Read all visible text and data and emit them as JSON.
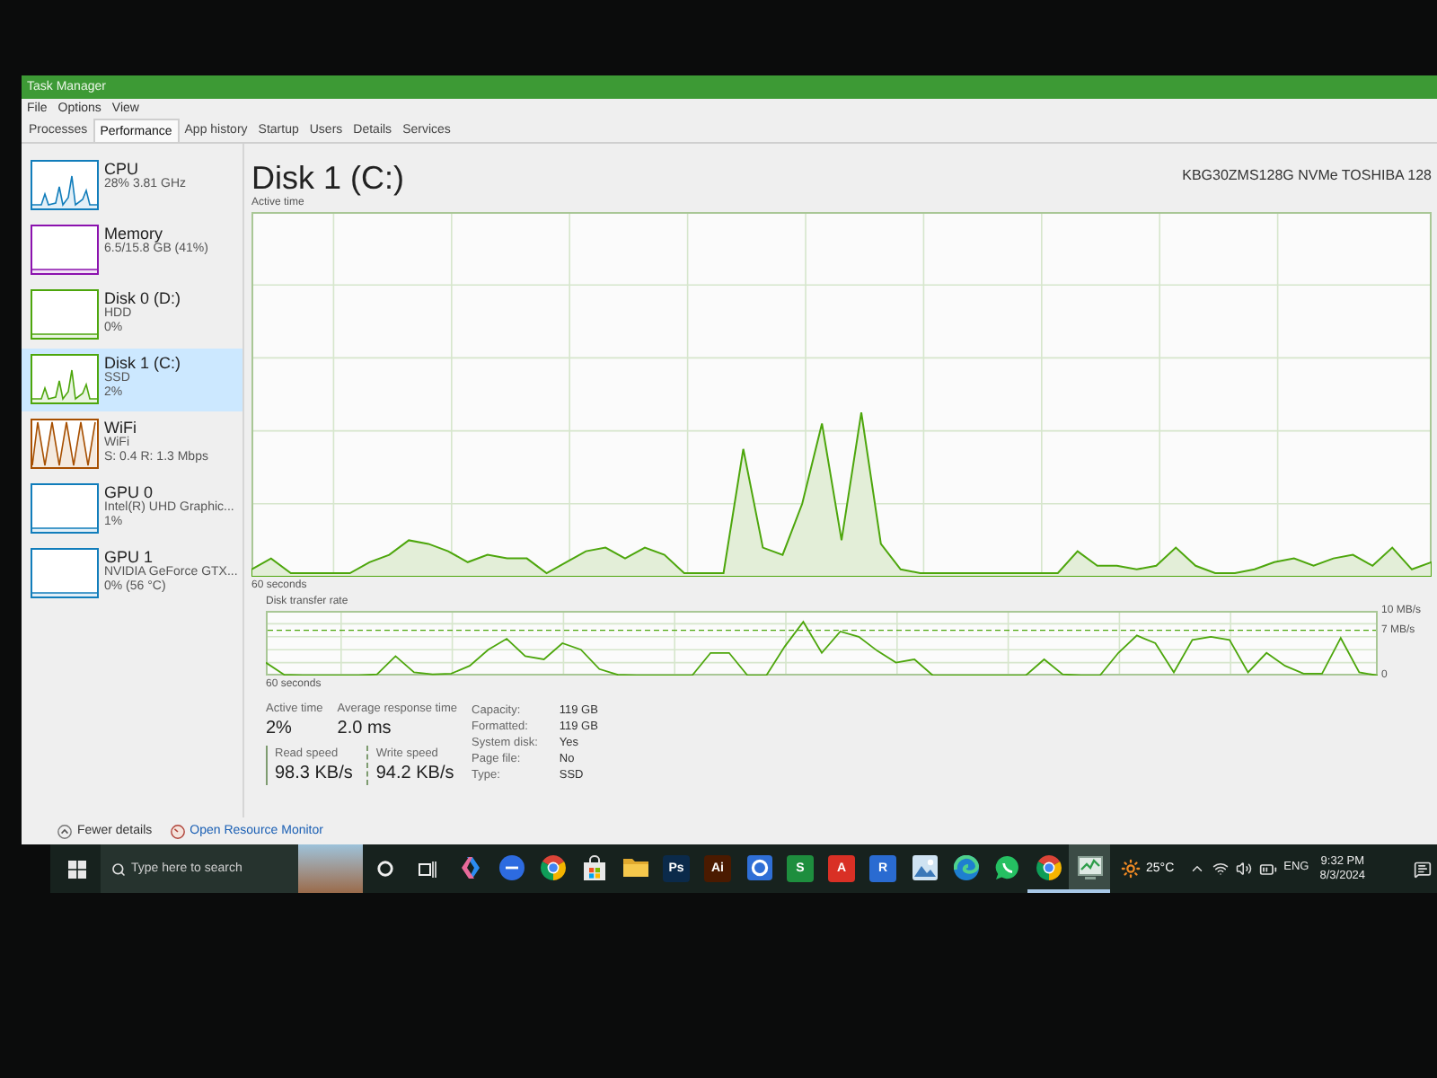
{
  "window": {
    "title": "Task Manager"
  },
  "menu": [
    "File",
    "Options",
    "View"
  ],
  "tabs": [
    {
      "label": "Processes",
      "selected": false
    },
    {
      "label": "Performance",
      "selected": true
    },
    {
      "label": "App history",
      "selected": false
    },
    {
      "label": "Startup",
      "selected": false
    },
    {
      "label": "Users",
      "selected": false
    },
    {
      "label": "Details",
      "selected": false
    },
    {
      "label": "Services",
      "selected": false
    }
  ],
  "sidebar": {
    "items": [
      {
        "name": "CPU",
        "details": [
          "28% 3.81 GHz"
        ],
        "color": "#117dbb",
        "kind": "spiky",
        "selected": false
      },
      {
        "name": "Memory",
        "details": [
          "6.5/15.8 GB (41%)"
        ],
        "color": "#8b12ae",
        "kind": "flat",
        "selected": false
      },
      {
        "name": "Disk 0 (D:)",
        "details": [
          "HDD",
          "0%"
        ],
        "color": "#4da60c",
        "kind": "flat",
        "selected": false
      },
      {
        "name": "Disk 1 (C:)",
        "details": [
          "SSD",
          "2%"
        ],
        "color": "#4da60c",
        "kind": "spiky",
        "selected": true
      },
      {
        "name": "WiFi",
        "details": [
          "WiFi",
          "S: 0.4 R: 1.3 Mbps"
        ],
        "color": "#a74f01",
        "kind": "wave",
        "selected": false
      },
      {
        "name": "GPU 0",
        "details": [
          "Intel(R) UHD Graphic...",
          "1%"
        ],
        "color": "#117dbb",
        "kind": "flat",
        "selected": false
      },
      {
        "name": "GPU 1",
        "details": [
          "NVIDIA GeForce GTX...",
          "0% (56 °C)"
        ],
        "color": "#117dbb",
        "kind": "flat",
        "selected": false
      }
    ]
  },
  "main": {
    "title": "Disk 1 (C:)",
    "model": "KBG30ZMS128G NVMe TOSHIBA 128",
    "active_time_graph": {
      "label": "Active time",
      "time_span": "60 seconds"
    },
    "transfer_graph": {
      "chart_data": {
        "type": "line",
        "title": "Disk transfer rate",
        "grid": true,
        "categories": [
          null,
          null,
          null,
          null,
          null,
          null,
          null,
          null,
          null,
          null,
          null,
          null,
          null,
          null,
          null,
          null,
          null,
          null,
          null,
          null,
          null,
          null,
          null,
          null,
          null,
          null,
          null,
          null,
          null,
          null,
          null,
          null,
          null,
          null,
          null,
          null,
          null,
          null,
          null,
          null,
          null,
          null,
          null,
          null,
          null,
          null,
          null,
          null,
          null,
          null,
          null,
          null,
          null,
          null,
          null,
          null,
          null,
          null,
          null,
          null,
          null
        ],
        "values": [
          2,
          0.1,
          0,
          0,
          0,
          0,
          0.2,
          3,
          0.5,
          0.2,
          0.3,
          1.5,
          4,
          5.7,
          3,
          2.5,
          5,
          4,
          1,
          0.1,
          0,
          0,
          0,
          0,
          3.5,
          3.5,
          0,
          0,
          4.5,
          8.3,
          3.5,
          6.8,
          6,
          3.8,
          2,
          2.5,
          0,
          0,
          0,
          0,
          0,
          0,
          2.5,
          0.2,
          0,
          0,
          3.5,
          6.2,
          5,
          0.5,
          5.5,
          6,
          5.5,
          0.5,
          3.5,
          1.5,
          0.3,
          0.3,
          5.8,
          0.5,
          0
        ],
        "ylim": [
          0,
          10
        ],
        "yticks": [
          {
            "value": 10,
            "label": "10 MB/s"
          },
          {
            "value": 0,
            "label": "0"
          }
        ],
        "ref_lines": [
          {
            "axis": "y",
            "value": 7,
            "label": "7 MB/s"
          }
        ],
        "annotations": [
          "60 seconds"
        ]
      }
    },
    "stats": {
      "active_time": {
        "label": "Active time",
        "value": "2%"
      },
      "response_time": {
        "label": "Average response time",
        "value": "2.0 ms"
      },
      "read_speed": {
        "label": "Read speed",
        "value": "98.3 KB/s"
      },
      "write_speed": {
        "label": "Write speed",
        "value": "94.2 KB/s"
      }
    },
    "properties": [
      {
        "label": "Capacity:",
        "value": "119 GB"
      },
      {
        "label": "Formatted:",
        "value": "119 GB"
      },
      {
        "label": "System disk:",
        "value": "Yes"
      },
      {
        "label": "Page file:",
        "value": "No"
      },
      {
        "label": "Type:",
        "value": "SSD"
      }
    ]
  },
  "footer": {
    "fewer_details": "Fewer details",
    "resource_monitor": "Open Resource Monitor"
  },
  "taskbar": {
    "search_placeholder": "Type here to search",
    "apps": [
      {
        "kind": "copilot",
        "open": false,
        "selected": false
      },
      {
        "kind": "disc",
        "open": false,
        "selected": false
      },
      {
        "kind": "chrome",
        "open": false,
        "selected": false
      },
      {
        "kind": "store",
        "open": false,
        "selected": false
      },
      {
        "kind": "folder",
        "open": false,
        "selected": false
      },
      {
        "kind": "tile",
        "label": "Ps",
        "color": "#0b2a4a",
        "open": false,
        "selected": false
      },
      {
        "kind": "tile",
        "label": "Ai",
        "color": "#4a1a00",
        "open": false,
        "selected": false
      },
      {
        "kind": "ring",
        "open": false,
        "selected": false
      },
      {
        "kind": "tile",
        "label": "S",
        "color": "#1e8e3e",
        "open": false,
        "selected": false
      },
      {
        "kind": "tile",
        "label": "A",
        "color": "#d93025",
        "open": false,
        "selected": false
      },
      {
        "kind": "tile",
        "label": "R",
        "color": "#2a6bd1",
        "open": false,
        "selected": false
      },
      {
        "kind": "picture",
        "open": false,
        "selected": false
      },
      {
        "kind": "edge",
        "open": false,
        "selected": false
      },
      {
        "kind": "chat",
        "open": false,
        "selected": false
      },
      {
        "kind": "chrome",
        "open": true,
        "selected": false
      },
      {
        "kind": "monitor",
        "open": true,
        "selected": true
      }
    ],
    "weather": "25°C",
    "language": "ENG",
    "time": "9:32 PM",
    "date": "8/3/2024"
  }
}
